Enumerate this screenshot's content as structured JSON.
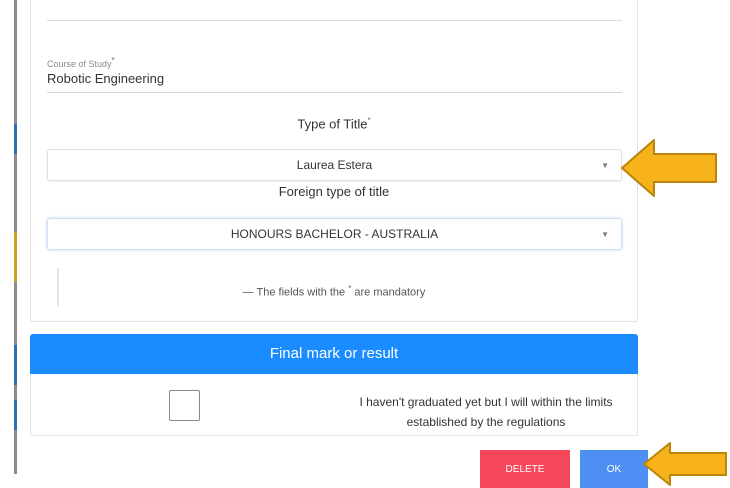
{
  "form": {
    "course_of_study_label": "Course of Study",
    "required_mark": "*",
    "course_of_study_value": "Robotic Engineering",
    "type_of_title_label": "Type of Title",
    "type_of_title_value": "Laurea Estera",
    "foreign_type_label": "Foreign type of title",
    "foreign_type_value": "HONOURS BACHELOR - AUSTRALIA",
    "mandatory_note_prefix": "— The fields with the",
    "mandatory_note_suffix": "are mandatory",
    "caret_icon": "caret-down-icon"
  },
  "final_mark": {
    "title": "Final mark or result",
    "not_graduated_label": "I haven't graduated yet but I will within the limits established by the regulations",
    "checked": false
  },
  "footer": {
    "delete_label": "DELETE",
    "ok_label": "OK"
  },
  "colors": {
    "header_blue": "#1a8cff",
    "delete_red": "#f5475a",
    "ok_blue": "#4d8ff2",
    "arrow_fill": "#f7b21b",
    "arrow_stroke": "#b8860b"
  }
}
